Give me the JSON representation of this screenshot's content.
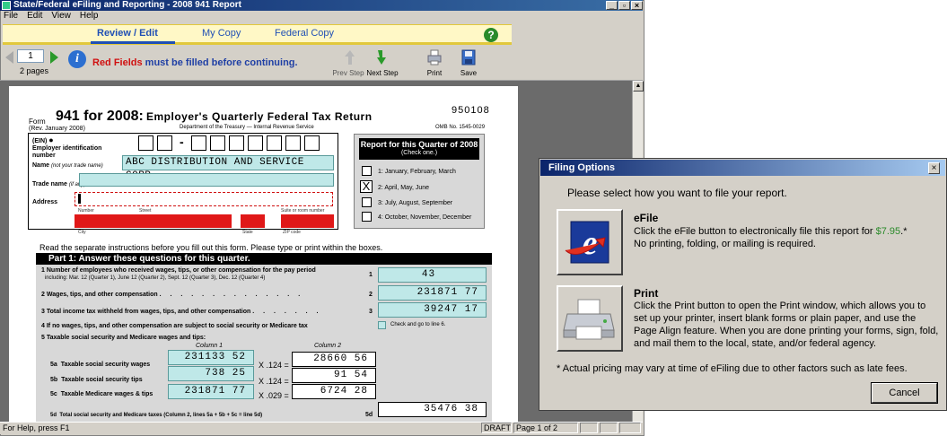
{
  "app": {
    "title": "State/Federal eFiling and Reporting - 2008 941 Report",
    "menu": [
      "File",
      "Edit",
      "View",
      "Help"
    ]
  },
  "tabs": {
    "review": "Review / Edit",
    "mycopy": "My Copy",
    "federal": "Federal Copy"
  },
  "toolbar": {
    "page_value": "1",
    "pages_label": "2 pages",
    "warn_red": "Red Fields",
    "warn_rest": " must be filled before continuing.",
    "prev_step": "Prev Step",
    "next_step": "Next Step",
    "print": "Print",
    "save": "Save"
  },
  "form": {
    "form_word": "Form",
    "form_title": "941 for 2008:",
    "subtitle": "Employer's Quarterly Federal Tax Return",
    "rev": "(Rev. January 2008)",
    "dept": "Department of the Treasury — Internal Revenue Service",
    "form_number": "950108",
    "omb": "OMB No. 1545-0029",
    "ein_label": "(EIN)",
    "ein_sub": "Employer identification number",
    "name_label": "Name",
    "name_hint": "(not your trade name)",
    "name_value": "ABC DISTRIBUTION AND SERVICE CORP.",
    "trade_label": "Trade name",
    "trade_hint": "(if any)",
    "address_label": "Address",
    "addr_number": "Number",
    "addr_street": "Street",
    "addr_suite": "Suite or room number",
    "addr_city": "City",
    "addr_state": "State",
    "addr_zip": "ZIP code",
    "quarter_title": "Report for this Quarter of 2008",
    "quarter_sub": "(Check one.)",
    "quarters": [
      "1: January, February, March",
      "2: April, May, June",
      "3: July, August, September",
      "4: October, November, December"
    ],
    "quarter_checked": "X",
    "read_instructions": "Read the separate instructions before you fill out this form. Please type or print within the boxes.",
    "part1": "Part 1: Answer these questions for this quarter.",
    "line1a": "Number of employees who received wages, tips, or other compensation for the pay period",
    "line1b": "including: Mar. 12 (Quarter 1),   June 12 (Quarter 2),   Sept. 12 (Quarter 3),   Dec. 12 (Quarter 4)",
    "line2": "Wages, tips, and other compensation",
    "line3": "Total income tax withheld from wages, tips, and other compensation",
    "line4": "If no wages, tips, and other compensation are subject to social security or Medicare tax",
    "line4_check": "Check and go to line 6.",
    "line5": "Taxable social security and Medicare wages and tips:",
    "col1": "Column 1",
    "col2": "Column 2",
    "line5a": "Taxable social security wages",
    "line5b": "Taxable social security tips",
    "line5c": "Taxable Medicare wages & tips",
    "mult_a": "X .124 =",
    "mult_b": "X .124 =",
    "mult_c": "X .029 =",
    "line5d": "Total social security and Medicare taxes (Column 2, lines 5a + 5b + 5c = line 5d)",
    "num": {
      "n1": "1",
      "n2": "2",
      "n3": "3",
      "n4": "4",
      "n5": "5",
      "n5a": "5a",
      "n5b": "5b",
      "n5c": "5c",
      "n5d": "5d"
    },
    "values": {
      "employees": "43",
      "wages": "231871 77",
      "withheld": "39247 17",
      "ss_wages_c1": "231133 52",
      "ss_wages_c2": "28660 56",
      "ss_tips_c1": "738 25",
      "ss_tips_c2": "91 54",
      "medicare_c1": "231871 77",
      "medicare_c2": "6724 28",
      "total_5d": "35476 38"
    }
  },
  "status": {
    "help": "For Help, press F1",
    "draft": "DRAFT",
    "page": "Page 1 of 2"
  },
  "dialog": {
    "title": "Filing Options",
    "close": "×",
    "prompt": "Please select how you want to file your report.",
    "efile_title": "eFile",
    "efile_desc1": "Click the eFile button to electronically file this report for ",
    "efile_price": "$7.95",
    "efile_desc2": ".*",
    "efile_desc3": "No printing, folding, or mailing is required.",
    "print_title": "Print",
    "print_desc": "Click the Print button to open the Print window, which allows you to set up your printer, insert blank forms or plain paper, and use the Page Align feature. When you are done printing your forms, sign, fold, and mail them to the local, state, and/or federal agency.",
    "note": "* Actual pricing may vary at time of eFiling due to other factors such as late fees.",
    "cancel": "Cancel"
  },
  "colors": {
    "accent": "#1f4fb5",
    "required": "#e01818",
    "filled": "#bfe8e8",
    "price": "#2a8a2a"
  }
}
